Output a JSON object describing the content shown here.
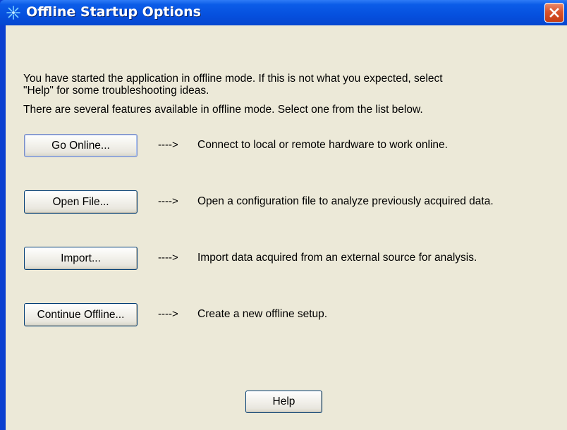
{
  "window": {
    "title": "Offline Startup Options",
    "title_bar_color": "#0650de",
    "client_background": "#ece9d8"
  },
  "intro": {
    "line1": "You have started the application in offline mode. If this is not what you expected, select",
    "line2": "\"Help\" for some troubleshooting ideas.",
    "line3": "There are several features available in offline mode. Select one from the list below."
  },
  "options": [
    {
      "button": "Go Online...",
      "arrow": "---->",
      "description": "Connect to local or remote hardware to work online."
    },
    {
      "button": "Open File...",
      "arrow": "---->",
      "description": "Open a configuration file to analyze previously acquired data."
    },
    {
      "button": "Import...",
      "arrow": "---->",
      "description": "Import data acquired from an external source for analysis."
    },
    {
      "button": "Continue Offline...",
      "arrow": "---->",
      "description": "Create a new offline setup."
    }
  ],
  "help": {
    "label": "Help"
  },
  "icons": {
    "app": "asterisk-burst-icon",
    "close": "close-icon"
  }
}
